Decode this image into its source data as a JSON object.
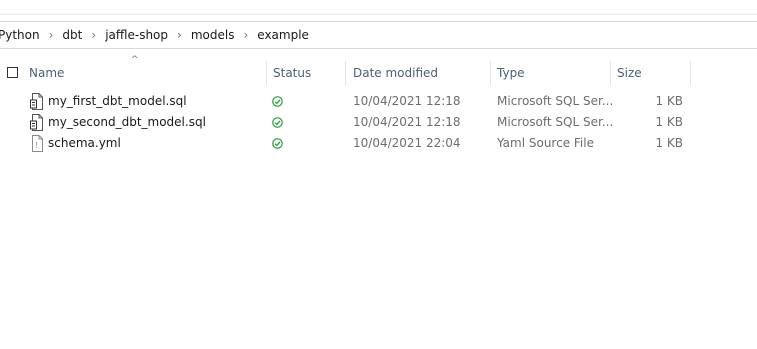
{
  "breadcrumb": [
    "Python",
    "dbt",
    "jaffle-shop",
    "models",
    "example"
  ],
  "columns": {
    "name": "Name",
    "status": "Status",
    "date_modified": "Date modified",
    "type": "Type",
    "size": "Size"
  },
  "files": [
    {
      "name": "my_first_dbt_model.sql",
      "date": "10/04/2021 12:18",
      "type": "Microsoft SQL Ser...",
      "size": "1 KB",
      "icon": "sql-file-icon",
      "status_icon": "sync-ok-icon"
    },
    {
      "name": "my_second_dbt_model.sql",
      "date": "10/04/2021 12:18",
      "type": "Microsoft SQL Ser...",
      "size": "1 KB",
      "icon": "sql-file-icon",
      "status_icon": "sync-ok-icon"
    },
    {
      "name": "schema.yml",
      "date": "10/04/2021 22:04",
      "type": "Yaml Source File",
      "size": "1 KB",
      "icon": "yaml-file-icon",
      "status_icon": "sync-ok-icon"
    }
  ],
  "colors": {
    "status_ok": "#2e9b3b",
    "header_text": "#4c607a"
  }
}
